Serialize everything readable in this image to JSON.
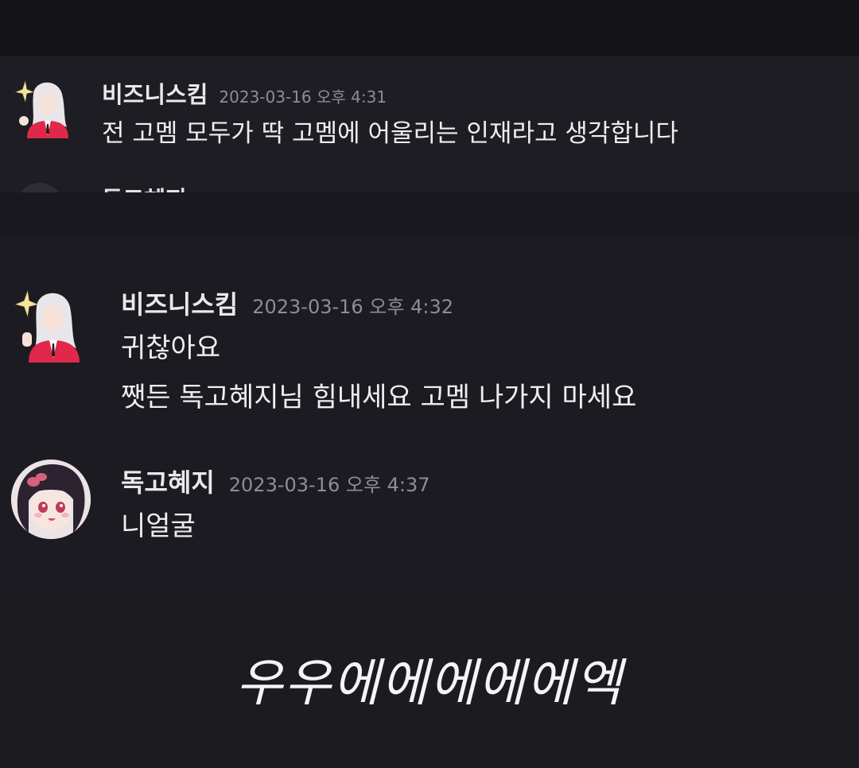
{
  "messages": [
    {
      "username": "비즈니스킴",
      "timestamp": "2023-03-16 오후 4:31",
      "lines": [
        "전 고멤 모두가 딱 고멤에 어울리는 인재라고 생각합니다"
      ]
    },
    {
      "username": "독고혜지",
      "timestamp": "",
      "lines": []
    },
    {
      "username": "비즈니스킴",
      "timestamp": "2023-03-16 오후 4:32",
      "lines": [
        "귀찮아요",
        "쨋든 독고혜지님 힘내세요 고멤 나가지 마세요"
      ]
    },
    {
      "username": "독고혜지",
      "timestamp": "2023-03-16 오후 4:37",
      "lines": [
        "니얼굴"
      ]
    }
  ],
  "caption": "우우에에에에에엑",
  "colors": {
    "background": "#1b1a20",
    "username": "#e9e9ec",
    "timestamp": "#8d8d93",
    "message_text": "#eeeef0",
    "avatar_accent": "#e0284b"
  },
  "icons": {
    "bizkim_avatar": "white-haired-character-avatar",
    "dokgo_avatar": "dark-haired-character-avatar",
    "sparkle": "sparkle-icon"
  }
}
